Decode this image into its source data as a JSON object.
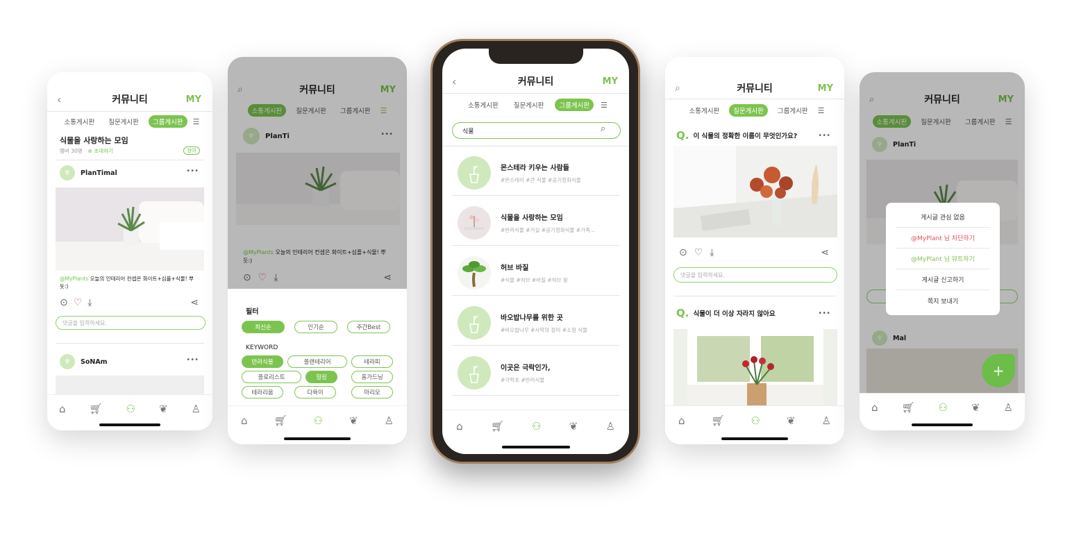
{
  "colors": {
    "accent": "#7cc44f",
    "danger": "#e05050"
  },
  "phone1": {
    "title": "커뮤니티",
    "my": "MY",
    "tabs": [
      "소통게시판",
      "질문게시판",
      "그룹게시판"
    ],
    "active_tab": 2,
    "group_name": "식물을 사랑하는 모임",
    "members": "멤버 30명",
    "invite": "초대하기",
    "join": "참여",
    "post1_user": "PlanTimal",
    "post1_mention": "@MyPlants",
    "post1_text": "오늘의 인테리어 컨셉은 화이트+심플+식물! 뿌듯:)",
    "comment_placeholder": "댓글을 입력하세요.",
    "post2_user": "SoNAm"
  },
  "phone2": {
    "title": "커뮤니티",
    "my": "MY",
    "tabs": [
      "소통게시판",
      "질문게시판",
      "그룹게시판"
    ],
    "active_tab": 0,
    "post_user": "PlanTi",
    "mention": "@MyPlants",
    "text": "오늘의 인테리어 컨셉은 화이트+심플+식물! 뿌듯:)",
    "filter_title": "필터",
    "sort": [
      "최신순",
      "인기순",
      "주간Best"
    ],
    "keyword_title": "KEYWORD",
    "keywords": [
      "반려식물",
      "플랜테리어",
      "테라피",
      "플로리스트",
      "힐링",
      "홈가드닝",
      "테라리움",
      "다육이",
      "마리모"
    ],
    "keywords_on": [
      0,
      4
    ]
  },
  "phone3": {
    "title": "커뮤니티",
    "my": "MY",
    "tabs": [
      "소통게시판",
      "질문게시판",
      "그룹게시판"
    ],
    "active_tab": 2,
    "search_value": "식물",
    "groups": [
      {
        "name": "몬스테라 키우는 사람들",
        "tags": "#몬스테라  #큰 식물  #공기정화식물"
      },
      {
        "name": "식물을 사랑하는 모임",
        "tags": "#반려식물  #거실  #공기정화식물  #가족..."
      },
      {
        "name": "허브 바질",
        "tags": "#식물  #허브  #바질  #허브 왕"
      },
      {
        "name": "바오밥나무를 위한 곳",
        "tags": "#바오밥나무  #사막의 장미  #소형 식물"
      },
      {
        "name": "이곳은 극락인가,",
        "tags": "#극락초  #반려식물"
      }
    ]
  },
  "phone4": {
    "title": "커뮤니티",
    "my": "MY",
    "tabs": [
      "소통게시판",
      "질문게시판",
      "그룹게시판"
    ],
    "active_tab": 1,
    "q": "Q.",
    "q1": "이 식물의 정확한 이름이 무엇인가요?",
    "q2": "식물이 더 이상 자라지 않아요",
    "comment_placeholder": "댓글을 입력하세요."
  },
  "phone5": {
    "title": "커뮤니티",
    "my": "MY",
    "tabs": [
      "소통게시판",
      "질문게시판",
      "그룹게시판"
    ],
    "active_tab": 0,
    "post_user": "PlanTi",
    "post2_user": "Mal",
    "menu": [
      "게시글 관심 없음",
      "@MyPlant 님 차단하기",
      "@MyPlant 님 뮤트하기",
      "게시글 신고하기",
      "쪽지 보내기"
    ],
    "menu_colors": [
      "#333",
      "#e05050",
      "#7cc44f",
      "#333",
      "#333"
    ]
  },
  "nav_icons": [
    "home-icon",
    "cart-icon",
    "community-icon",
    "plant-icon",
    "user-icon"
  ]
}
